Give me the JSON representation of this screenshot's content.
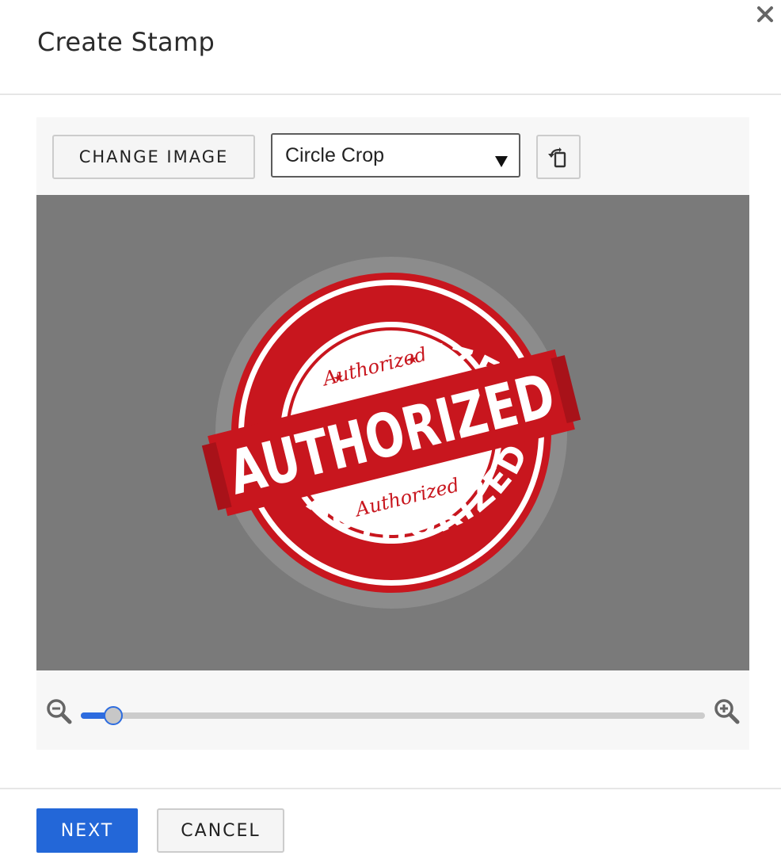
{
  "dialog": {
    "title": "Create Stamp",
    "close_icon": "close-icon"
  },
  "toolbar": {
    "change_image_label": "CHANGE IMAGE",
    "crop_select_value": "Circle Crop",
    "rotate_icon": "rotate-icon"
  },
  "canvas": {
    "stamp_text": {
      "top_arc": "AUTHORIZED",
      "inner_top_script": "Authorized",
      "band": "AUTHORIZED",
      "inner_bottom_script": "Authorized",
      "bottom_arc": "AUTHORIZED"
    }
  },
  "zoom": {
    "zoom_out_icon": "zoom-out-icon",
    "zoom_in_icon": "zoom-in-icon",
    "level": 0.05
  },
  "footer": {
    "next_label": "NEXT",
    "cancel_label": "CANCEL"
  },
  "colors": {
    "primary": "#2367d8",
    "stamp_red": "#c8161e",
    "canvas_bg": "#7a7a7a"
  }
}
